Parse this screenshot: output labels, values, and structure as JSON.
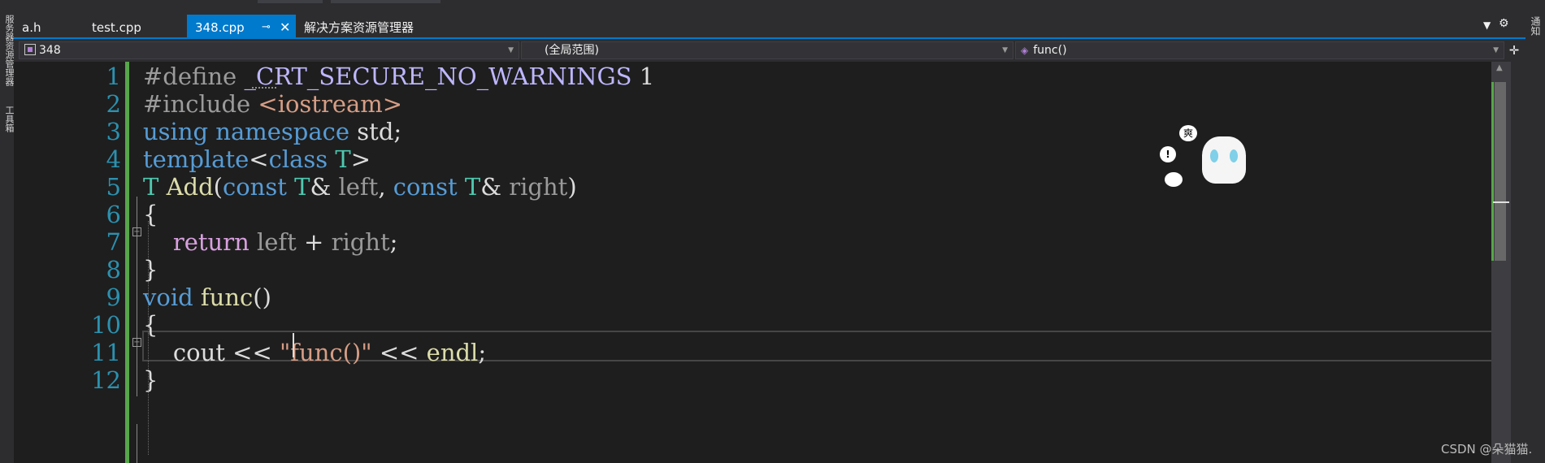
{
  "left_rail": {
    "items": [
      "服务器资源管理器",
      "工具箱"
    ]
  },
  "right_rail": {
    "label": "通知"
  },
  "tabs": [
    {
      "label": "a.h",
      "active": false
    },
    {
      "label": "test.cpp",
      "active": false
    },
    {
      "label": "348.cpp",
      "active": true
    },
    {
      "label": "解决方案资源管理器",
      "active": false
    }
  ],
  "tab_pin_icon": "pin-icon",
  "tab_close_icon": "close-icon",
  "navbar": {
    "project": "348",
    "scope": "(全局范围)",
    "member": "func()"
  },
  "editor": {
    "line_numbers": [
      "1",
      "2",
      "3",
      "4",
      "5",
      "6",
      "7",
      "8",
      "9",
      "10",
      "11",
      "12"
    ],
    "lines": [
      [
        {
          "t": "#define ",
          "c": "pp"
        },
        {
          "t": "_CRT_SECURE_NO_WARNINGS",
          "c": "macro"
        },
        {
          "t": " 1",
          "c": "plain"
        }
      ],
      [
        {
          "t": "#include ",
          "c": "pp"
        },
        {
          "t": "<iostream>",
          "c": "str"
        }
      ],
      [
        {
          "t": "using ",
          "c": "kw"
        },
        {
          "t": "namespace ",
          "c": "kw"
        },
        {
          "t": "std;",
          "c": "plain"
        }
      ],
      [
        {
          "t": "template",
          "c": "kw"
        },
        {
          "t": "<",
          "c": "plain"
        },
        {
          "t": "class ",
          "c": "kw"
        },
        {
          "t": "T",
          "c": "typ"
        },
        {
          "t": ">",
          "c": "plain"
        }
      ],
      [
        {
          "t": "T ",
          "c": "typ"
        },
        {
          "t": "Add",
          "c": "fn"
        },
        {
          "t": "(",
          "c": "plain"
        },
        {
          "t": "const ",
          "c": "kw"
        },
        {
          "t": "T",
          "c": "typ"
        },
        {
          "t": "& ",
          "c": "plain"
        },
        {
          "t": "left",
          "c": "param"
        },
        {
          "t": ", ",
          "c": "plain"
        },
        {
          "t": "const ",
          "c": "kw"
        },
        {
          "t": "T",
          "c": "typ"
        },
        {
          "t": "& ",
          "c": "plain"
        },
        {
          "t": "right",
          "c": "param"
        },
        {
          "t": ")",
          "c": "plain"
        }
      ],
      [
        {
          "t": "{",
          "c": "plain"
        }
      ],
      [
        {
          "t": "    ",
          "c": "plain"
        },
        {
          "t": "return ",
          "c": "ctl"
        },
        {
          "t": "left",
          "c": "param"
        },
        {
          "t": " + ",
          "c": "plain"
        },
        {
          "t": "right",
          "c": "param"
        },
        {
          "t": ";",
          "c": "plain"
        }
      ],
      [
        {
          "t": "}",
          "c": "plain"
        }
      ],
      [
        {
          "t": "void ",
          "c": "kw"
        },
        {
          "t": "func",
          "c": "fn"
        },
        {
          "t": "()",
          "c": "plain"
        }
      ],
      [
        {
          "t": "{",
          "c": "plain"
        }
      ],
      [
        {
          "t": "    ",
          "c": "plain"
        },
        {
          "t": "cout",
          "c": "plain"
        },
        {
          "t": " << ",
          "c": "plain"
        },
        {
          "t": "\"func()\"",
          "c": "str"
        },
        {
          "t": " << ",
          "c": "plain"
        },
        {
          "t": "endl",
          "c": "fn"
        },
        {
          "t": ";",
          "c": "plain"
        }
      ],
      [
        {
          "t": "}",
          "c": "plain"
        }
      ]
    ]
  },
  "sticker": {
    "bubble_text": "爽"
  },
  "watermark": "CSDN @朵猫猫."
}
